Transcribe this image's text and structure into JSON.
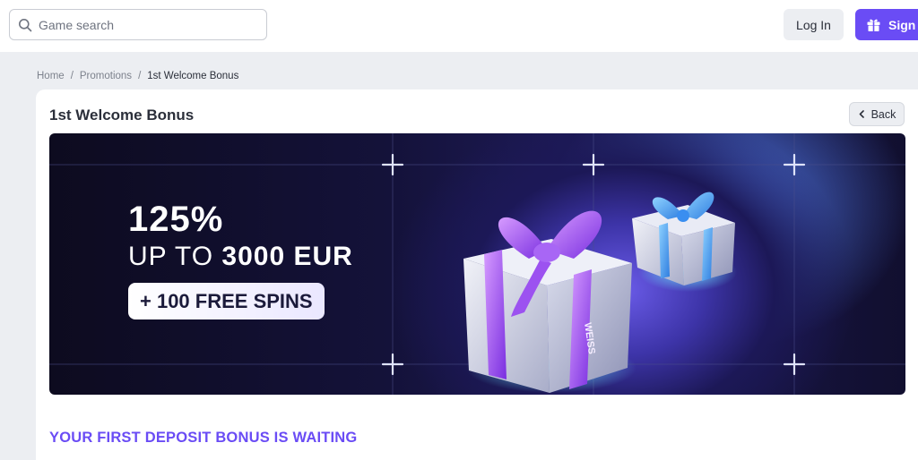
{
  "header": {
    "search_placeholder": "Game search",
    "login_label": "Log In",
    "sign_label": "Sign"
  },
  "breadcrumb": {
    "items": [
      "Home",
      "Promotions",
      "1st Welcome Bonus"
    ],
    "separator": "/"
  },
  "page": {
    "title": "1st Welcome Bonus",
    "back_label": "Back"
  },
  "banner": {
    "headline": "125%",
    "sub_prefix": "UP TO ",
    "sub_amount": "3000 EUR",
    "spins": "+ 100 FREE SPINS",
    "gift_brand": "WEISS"
  },
  "section": {
    "title": "YOUR FIRST DEPOSIT BONUS IS WAITING"
  },
  "colors": {
    "accent": "#6a4cf5",
    "page_bg": "#eceef2",
    "banner_dark": "#0d0b1f"
  },
  "icons": {
    "search": "search-icon",
    "gift": "gift-icon",
    "back": "chevron-left-icon"
  }
}
